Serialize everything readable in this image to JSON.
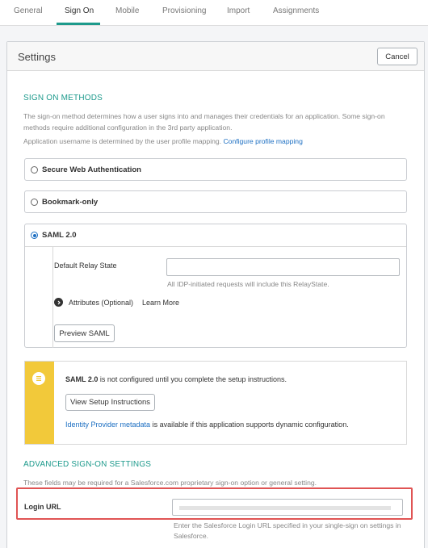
{
  "tabs": [
    {
      "label": "General",
      "active": false
    },
    {
      "label": "Sign On",
      "active": true
    },
    {
      "label": "Mobile",
      "active": false
    },
    {
      "label": "Provisioning",
      "active": false
    },
    {
      "label": "Import",
      "active": false
    },
    {
      "label": "Assignments",
      "active": false
    }
  ],
  "settings": {
    "title": "Settings",
    "cancel_label": "Cancel"
  },
  "sign_on_methods": {
    "heading": "SIGN ON METHODS",
    "description": "The sign-on method determines how a user signs into and manages their credentials for an application. Some sign-on methods require additional configuration in the 3rd party application.",
    "username_note": "Application username is determined by the user profile mapping.",
    "profile_mapping_link": "Configure profile mapping",
    "options": [
      {
        "label": "Secure Web Authentication",
        "selected": false
      },
      {
        "label": "Bookmark-only",
        "selected": false
      },
      {
        "label": "SAML 2.0",
        "selected": true
      }
    ]
  },
  "saml": {
    "relay_state_label": "Default Relay State",
    "relay_state_value": "",
    "relay_state_hint": "All IDP-initiated requests will include this RelayState.",
    "attributes_label": "Attributes (Optional)",
    "learn_more_link": "Learn More",
    "preview_label": "Preview SAML"
  },
  "notice": {
    "saml_bold": "SAML 2.0",
    "message": " is not configured until you complete the setup instructions.",
    "setup_button": "View Setup Instructions",
    "metadata_link": "Identity Provider metadata",
    "metadata_text": " is available if this application supports dynamic configuration.",
    "accent_color": "#f2c93a"
  },
  "advanced": {
    "heading": "ADVANCED SIGN-ON SETTINGS",
    "description": "These fields may be required for a Salesforce.com proprietary sign-on option or general setting.",
    "login_url_label": "Login URL",
    "login_url_value": "",
    "login_url_hint": "Enter the Salesforce Login URL specified in your single-sign on settings in Salesforce.",
    "highlight_color": "#e05454"
  },
  "colors": {
    "accent": "#1d9a8c",
    "link": "#1b6ec2"
  }
}
